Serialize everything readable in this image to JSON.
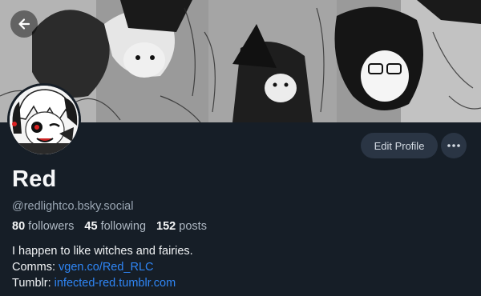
{
  "profile": {
    "display_name": "Red",
    "handle": "@redlightco.bsky.social",
    "stats": {
      "followers_count": "80",
      "followers_label": "followers",
      "following_count": "45",
      "following_label": "following",
      "posts_count": "152",
      "posts_label": "posts"
    },
    "bio": {
      "line1": "I happen to like witches and fairies.",
      "comms_label": "Comms:",
      "comms_link": "vgen.co/Red_RLC",
      "tumblr_label": "Tumblr:",
      "tumblr_link": "infected-red.tumblr.com"
    }
  },
  "actions": {
    "edit_profile_label": "Edit Profile",
    "more_icon": "ellipsis-icon",
    "back_icon": "arrow-left-icon"
  },
  "colors": {
    "background": "#161e27",
    "button_bg": "#2a3544",
    "link": "#2f86f6",
    "muted_text": "#9aa6b3"
  }
}
